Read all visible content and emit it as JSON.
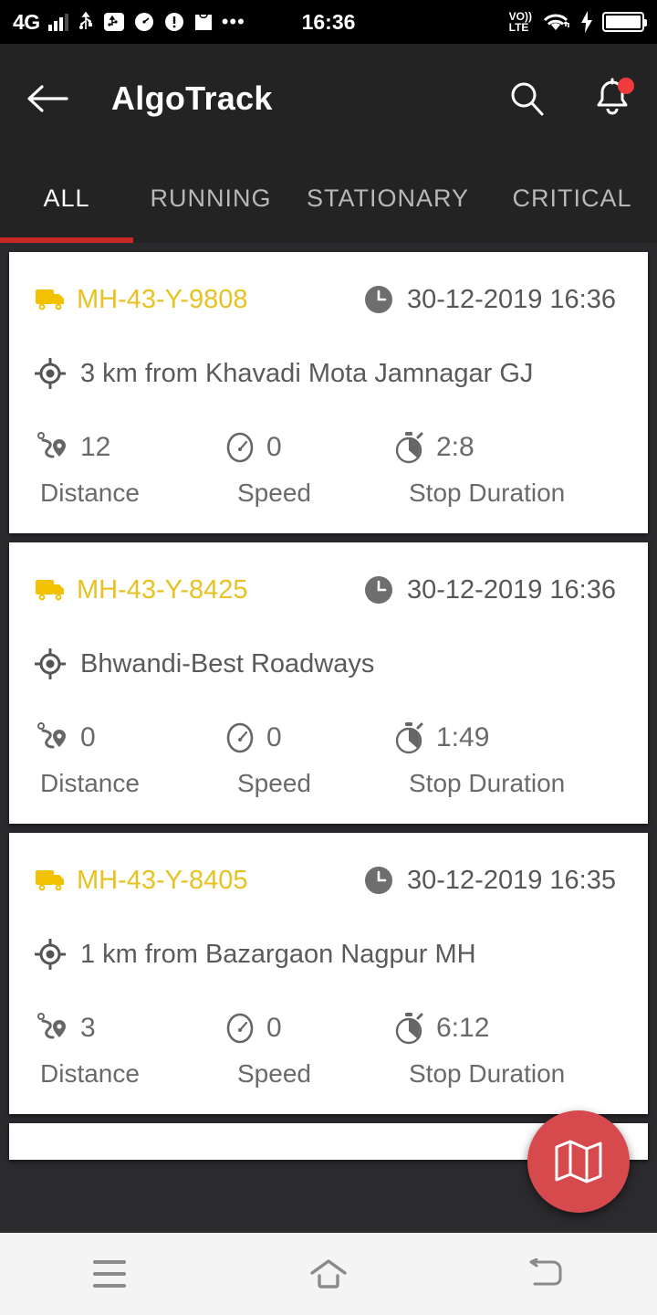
{
  "status_bar": {
    "network": "4G",
    "clock": "16:36",
    "volte_top": "VO))",
    "volte_bottom": "LTE",
    "icons": [
      "signal-bars-icon",
      "usb-icon",
      "usb-debug-icon",
      "speed-meter-icon",
      "warning-icon",
      "shopping-bag-icon",
      "more-dots-icon",
      "volte-icon",
      "wifi-icon",
      "charging-bolt-icon",
      "battery-icon"
    ]
  },
  "appbar": {
    "title": "AlgoTrack",
    "back_icon": "back-arrow-icon",
    "search_icon": "search-icon",
    "notification_icon": "bell-icon",
    "has_notification_badge": true
  },
  "tabs": {
    "items": [
      {
        "label": "ALL",
        "active": true
      },
      {
        "label": "RUNNING",
        "active": false
      },
      {
        "label": "STATIONARY",
        "active": false
      },
      {
        "label": "CRITICAL",
        "active": false
      }
    ],
    "indicator_color": "#c62828"
  },
  "stat_labels": {
    "distance": "Distance",
    "speed": "Speed",
    "stop_duration": "Stop Duration"
  },
  "vehicles": [
    {
      "number": "MH-43-Y-9808",
      "timestamp": "30-12-2019 16:36",
      "location": "3 km from Khavadi Mota Jamnagar GJ",
      "distance": "12",
      "speed": "0",
      "stop_duration": "2:8"
    },
    {
      "number": "MH-43-Y-8425",
      "timestamp": "30-12-2019 16:36",
      "location": "Bhwandi-Best Roadways",
      "distance": "0",
      "speed": "0",
      "stop_duration": "1:49"
    },
    {
      "number": "MH-43-Y-8405",
      "timestamp": "30-12-2019 16:35",
      "location": "1 km from Bazargaon Nagpur MH",
      "distance": "3",
      "speed": "0",
      "stop_duration": "6:12"
    }
  ],
  "fab": {
    "icon": "map-icon",
    "color": "#d6494c"
  },
  "navbar": {
    "menu_icon": "menu-icon",
    "home_icon": "home-icon",
    "back_icon": "back-icon"
  },
  "colors": {
    "vehicle_yellow": "#e8c222",
    "accent_red": "#c62828",
    "appbar_bg": "#232323",
    "page_bg": "#2b2b2e"
  }
}
